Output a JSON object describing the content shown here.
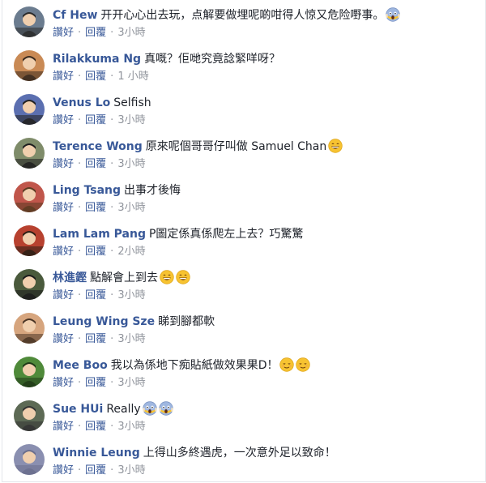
{
  "comments": [
    {
      "author": "Cf Hew",
      "text": "开开心心出去玩，点解要做埋呢啲咁得人惊又危险嘢事。",
      "emojis": [
        "scream-emoji"
      ],
      "like": "讚好",
      "reply": "回覆",
      "time": "3小時",
      "avatar_color": "#6b7c8f"
    },
    {
      "author": "Rilakkuma Ng",
      "text": "真嘅？佢哋究竟諗緊咩呀？",
      "emojis": [],
      "like": "讚好",
      "reply": "回覆",
      "time": "1 小時",
      "avatar_color": "#c98a55"
    },
    {
      "author": "Venus Lo",
      "text": "Selfish",
      "emojis": [],
      "like": "讚好",
      "reply": "回覆",
      "time": "3小時",
      "avatar_color": "#5b6fb0"
    },
    {
      "author": "Terence Wong",
      "text": "原來呢個哥哥仔叫做 Samuel Chan",
      "emojis": [
        "grin-emoji"
      ],
      "like": "讚好",
      "reply": "回覆",
      "time": "3小時",
      "avatar_color": "#7f8c6a"
    },
    {
      "author": "Ling Tsang",
      "text": "出事才後悔",
      "emojis": [],
      "like": "讚好",
      "reply": "回覆",
      "time": "3小時",
      "avatar_color": "#c0564b"
    },
    {
      "author": "Lam Lam Pang",
      "text": "P圖定係真係爬左上去？巧驚驚",
      "emojis": [],
      "like": "讚好",
      "reply": "回覆",
      "time": "2小時",
      "avatar_color": "#b7412f"
    },
    {
      "author": "林進鏗",
      "text": "點解會上到去",
      "emojis": [
        "grin-emoji",
        "grin-emoji"
      ],
      "like": "讚好",
      "reply": "回覆",
      "time": "3小時",
      "avatar_color": "#4a5a3c"
    },
    {
      "author": "Leung Wing Sze",
      "text": "睇到腳都軟",
      "emojis": [],
      "like": "讚好",
      "reply": "回覆",
      "time": "3小時",
      "avatar_color": "#d6a57e"
    },
    {
      "author": "Mee Boo",
      "text": "我以為係地下痴貼紙做效果果D！",
      "emojis": [
        "relieved-emoji",
        "relieved-emoji"
      ],
      "like": "讚好",
      "reply": "回覆",
      "time": "3小時",
      "avatar_color": "#4f8a3a"
    },
    {
      "author": "Sue HUi",
      "text": "Really",
      "emojis": [
        "scream-emoji",
        "scream-emoji"
      ],
      "like": "讚好",
      "reply": "回覆",
      "time": "3小時",
      "avatar_color": "#5d6a55"
    },
    {
      "author": "Winnie Leung",
      "text": "上得山多終遇虎，一次意外足以致命！",
      "emojis": [],
      "like": "讚好",
      "reply": "回覆",
      "time": "3小時",
      "avatar_color": "#8a8fb0"
    }
  ],
  "colors": {
    "author": "#385898",
    "text": "#1d2129",
    "meta": "#90949c",
    "emoji": "#f7c331"
  }
}
